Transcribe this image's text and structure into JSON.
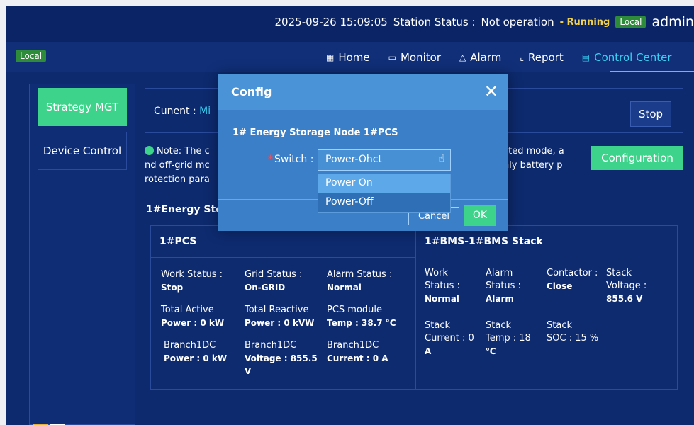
{
  "topbar": {
    "datetime": "2025-09-26 15:09:05",
    "station_status_label": "Station Status :",
    "station_status_value": "Not operation",
    "running_label": "- Running",
    "local_badge": "Local",
    "user": "admin"
  },
  "navbar": {
    "local_badge": "Local",
    "items": [
      {
        "label": "Home",
        "icon": "home-icon",
        "glyph": "▦"
      },
      {
        "label": "Monitor",
        "icon": "monitor-icon",
        "glyph": "▭"
      },
      {
        "label": "Alarm",
        "icon": "alarm-icon",
        "glyph": "△"
      },
      {
        "label": "Report",
        "icon": "report-icon",
        "glyph": "⌞"
      },
      {
        "label": "Control Center",
        "icon": "control-center-icon",
        "glyph": "▤"
      }
    ],
    "active": "Control Center"
  },
  "sidebar": {
    "items": [
      {
        "label": "Strategy MGT"
      },
      {
        "label": "Device Control"
      }
    ]
  },
  "main": {
    "current_label": "Cunent :",
    "current_mode": "Mi",
    "stop_label": "Stop",
    "note_text": "Note: The c",
    "note_line2": "nd off-grid mc",
    "note_line3": "rotection para",
    "note_right1": "ected mode, a",
    "note_right2": "only battery p",
    "config_label": "Configuration",
    "node_title": "1#Energy Sto"
  },
  "pcs": {
    "title": "1#PCS",
    "cells": [
      {
        "label": "Work Status :",
        "value": "Stop"
      },
      {
        "label": "Grid Status :",
        "value": "On-GRID"
      },
      {
        "label": "Alarm Status :",
        "value": "Normal"
      },
      {
        "label": "Total Active",
        "value": "Power : 0 kW"
      },
      {
        "label": "Total Reactive",
        "value": "Power : 0 kVW"
      },
      {
        "label": "PCS module",
        "value": "Temp : 38.7 °C"
      },
      {
        "label": "Branch1DC",
        "value": "Power : 0 kW"
      },
      {
        "label": "Branch1DC",
        "value": "Voltage : 855.5"
      },
      {
        "label": "Branch1DC",
        "value": "Current : 0 A"
      },
      {
        "value_extra": "V"
      }
    ]
  },
  "bms": {
    "title": "1#BMS-1#BMS Stack",
    "cells": [
      {
        "label": "Work",
        "label2": "Status :",
        "value": "Normal"
      },
      {
        "label": "Alarm",
        "label2": "Status :",
        "value": "Alarm"
      },
      {
        "label": "Contactor :",
        "label2": "Close"
      },
      {
        "label": "Stack",
        "label2": "Voltage :",
        "value": "855.6 V"
      },
      {
        "label": "Stack",
        "label2": "Current : 0",
        "value": "A"
      },
      {
        "label": "Stack",
        "label2": "Temp : 18",
        "value": "℃"
      },
      {
        "label": "Stack",
        "label2": "SOC : 15 %"
      }
    ]
  },
  "dialog": {
    "title": "Config",
    "node": "1# Energy Storage Node 1#PCS",
    "switch_label": "Switch :",
    "switch_value": "Power-Ohct",
    "options": [
      "Power On",
      "Power-Off"
    ],
    "cancel_label": "Cancel",
    "ok_label": "OK"
  },
  "colors": {
    "accent": "#37d0f2",
    "primary_green": "#3dd38a",
    "background": "#0d2a6e",
    "dialog": "#3a7fc8"
  }
}
